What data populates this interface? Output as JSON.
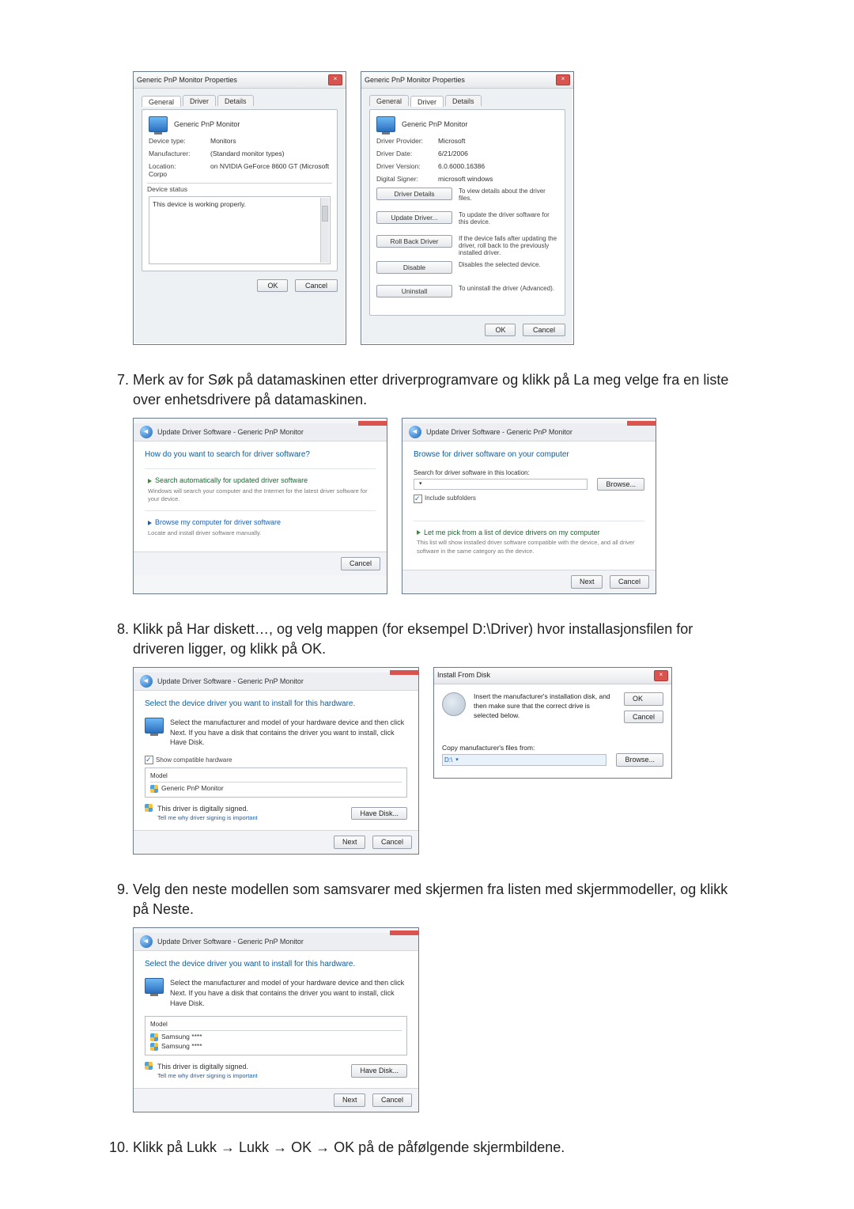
{
  "steps": {
    "s7": "Merk av for Søk på datamaskinen etter driverprogramvare og klikk på La meg velge fra en liste over enhetsdrivere på datamaskinen.",
    "s8": "Klikk på Har diskett…, og velg mappen (for eksempel D:\\Driver) hvor installasjonsfilen for driveren ligger, og klikk på OK.",
    "s9": "Velg den neste modellen som samsvarer med skjermen fra listen med skjermmodeller, og klikk på Neste.",
    "s10": "Klikk på Lukk → Lukk → OK → OK på de påfølgende skjermbildene."
  },
  "common": {
    "ok": "OK",
    "cancel": "Cancel",
    "next": "Next",
    "browse": "Browse...",
    "have_disk": "Have Disk..."
  },
  "dlg_general": {
    "title": "Generic PnP Monitor Properties",
    "tabs": {
      "general": "General",
      "driver": "Driver",
      "details": "Details"
    },
    "name": "Generic PnP Monitor",
    "device_type_k": "Device type:",
    "device_type_v": "Monitors",
    "manufacturer_k": "Manufacturer:",
    "manufacturer_v": "(Standard monitor types)",
    "location_k": "Location:",
    "location_v": "on NVIDIA GeForce 8600 GT (Microsoft Corpo",
    "device_status_grp": "Device status",
    "device_status_txt": "This device is working properly."
  },
  "dlg_driver": {
    "title": "Generic PnP Monitor Properties",
    "name": "Generic PnP Monitor",
    "provider_k": "Driver Provider:",
    "provider_v": "Microsoft",
    "date_k": "Driver Date:",
    "date_v": "6/21/2006",
    "version_k": "Driver Version:",
    "version_v": "6.0.6000.16386",
    "signer_k": "Digital Signer:",
    "signer_v": "microsoft windows",
    "btn_details": "Driver Details",
    "btn_details_desc": "To view details about the driver files.",
    "btn_update": "Update Driver...",
    "btn_update_desc": "To update the driver software for this device.",
    "btn_rollback": "Roll Back Driver",
    "btn_rollback_desc": "If the device fails after updating the driver, roll back to the previously installed driver.",
    "btn_disable": "Disable",
    "btn_disable_desc": "Disables the selected device.",
    "btn_uninstall": "Uninstall",
    "btn_uninstall_desc": "To uninstall the driver (Advanced)."
  },
  "wiz": {
    "title": "Update Driver Software - Generic PnP Monitor",
    "q_search": "How do you want to search for driver software?",
    "auto_title": "Search automatically for updated driver software",
    "auto_sub": "Windows will search your computer and the Internet for the latest driver software for your device.",
    "browse_title": "Browse my computer for driver software",
    "browse_sub": "Locate and install driver software manually.",
    "browse_hdr": "Browse for driver software on your computer",
    "search_loc": "Search for driver software in this location:",
    "path": "",
    "include_sub": "Include subfolders",
    "pick_title": "Let me pick from a list of device drivers on my computer",
    "pick_sub": "This list will show installed driver software compatible with the device, and all driver software in the same category as the device.",
    "select_hdr": "Select the device driver you want to install for this hardware.",
    "select_sub": "Select the manufacturer and model of your hardware device and then click Next. If you have a disk that contains the driver you want to install, click Have Disk.",
    "show_compat": "Show compatible hardware",
    "model_col": "Model",
    "model_item1": "Generic PnP Monitor",
    "model_a": "Samsung ****",
    "model_b": "Samsung ****",
    "signed": "This driver is digitally signed.",
    "tell_me": "Tell me why driver signing is important"
  },
  "ifd": {
    "title": "Install From Disk",
    "text": "Insert the manufacturer's installation disk, and then make sure that the correct drive is selected below.",
    "copy_from": "Copy manufacturer's files from:",
    "path": "D:\\"
  }
}
